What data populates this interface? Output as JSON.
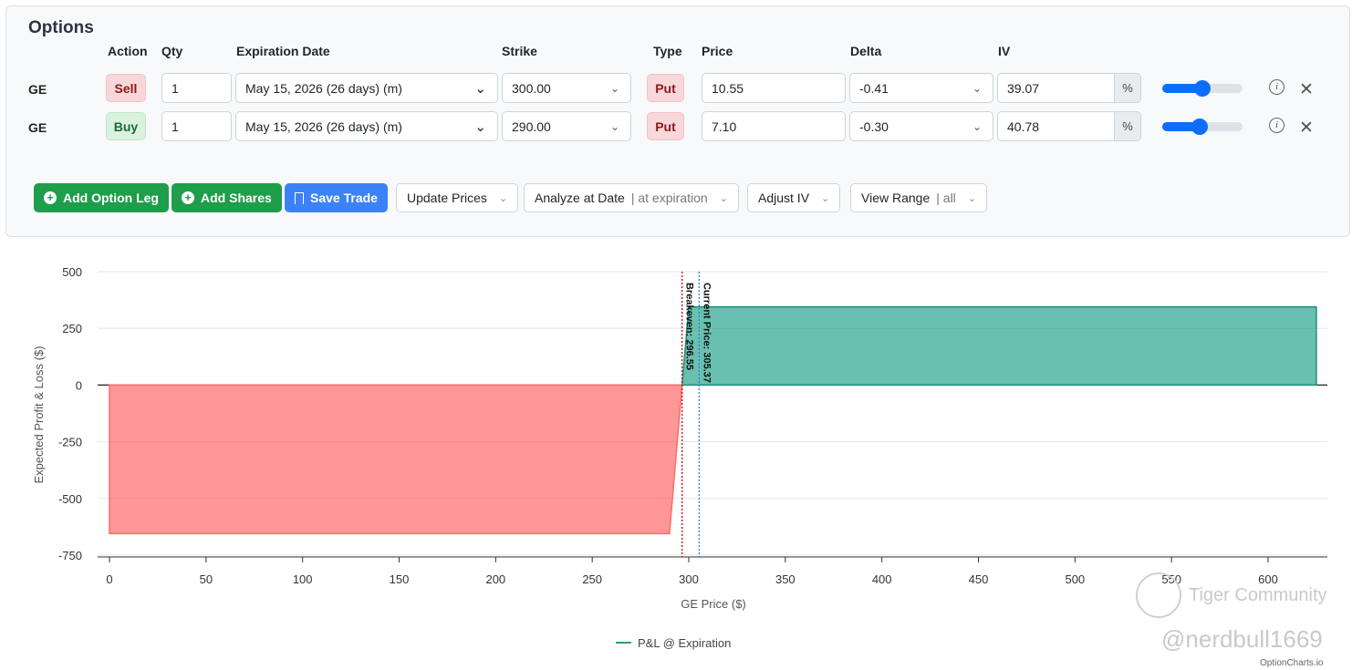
{
  "panel": {
    "title": "Options",
    "headers": {
      "action": "Action",
      "qty": "Qty",
      "expiration": "Expiration Date",
      "strike": "Strike",
      "type": "Type",
      "price": "Price",
      "delta": "Delta",
      "iv": "IV"
    },
    "legs": [
      {
        "symbol": "GE",
        "action": "Sell",
        "qty": "1",
        "expiration": "May 15, 2026 (26 days) (m)",
        "strike": "300.00",
        "type": "Put",
        "price": "10.55",
        "delta": "-0.41",
        "iv": "39.07",
        "iv_unit": "%",
        "iv_slider": 0.5
      },
      {
        "symbol": "GE",
        "action": "Buy",
        "qty": "1",
        "expiration": "May 15, 2026 (26 days) (m)",
        "strike": "290.00",
        "type": "Put",
        "price": "7.10",
        "delta": "-0.30",
        "iv": "40.78",
        "iv_unit": "%",
        "iv_slider": 0.47
      }
    ],
    "buttons": {
      "add_leg": "Add Option Leg",
      "add_shares": "Add Shares",
      "save": "Save Trade",
      "update_prices": "Update Prices",
      "analyze": "Analyze at Date",
      "analyze_sub": "| at expiration",
      "adjust_iv": "Adjust IV",
      "view_range": "View Range",
      "view_range_sub": "| all"
    }
  },
  "chart_data": {
    "type": "area",
    "xlabel": "GE Price ($)",
    "ylabel": "Expected Profit & Loss ($)",
    "xlim": [
      0,
      630
    ],
    "ylim": [
      -750,
      500
    ],
    "xticks": [
      0,
      50,
      100,
      150,
      200,
      250,
      300,
      350,
      400,
      450,
      500,
      550,
      600
    ],
    "yticks": [
      500,
      250,
      0,
      -250,
      -500,
      -750
    ],
    "series": [
      {
        "name": "P&L @ Expiration",
        "x": [
          0,
          290,
          296.55,
          300,
          625
        ],
        "y": [
          -655,
          -655,
          0,
          345,
          345
        ]
      }
    ],
    "annotations": [
      {
        "label": "Breakeven: 296.55",
        "x": 296.55,
        "color": "#cc0000"
      },
      {
        "label": "Current Price: 305.37",
        "x": 305.37,
        "color": "#3b7fc4"
      }
    ],
    "legend_position": "bottom-center",
    "colors": {
      "profit": "#2aa590",
      "loss": "#ff6b6b"
    }
  },
  "watermark": {
    "community": "Tiger Community",
    "handle": "@nerdbull1669",
    "brand": "OptionCharts.io"
  }
}
